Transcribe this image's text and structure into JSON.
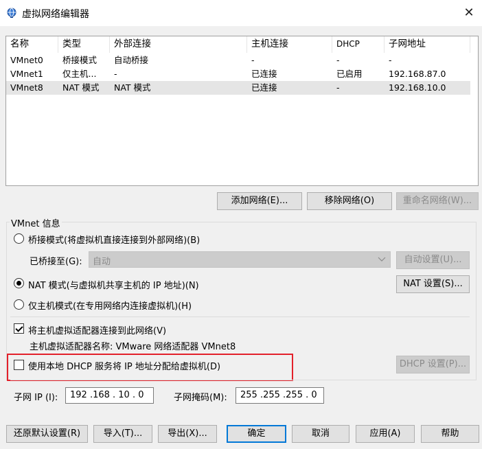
{
  "window": {
    "title": "虚拟网络编辑器",
    "close_label": "✕"
  },
  "list": {
    "headers": [
      "名称",
      "类型",
      "外部连接",
      "主机连接",
      "DHCP",
      "子网地址"
    ],
    "rows": [
      {
        "name": "VMnet0",
        "type": "桥接模式",
        "external": "自动桥接",
        "host": "-",
        "dhcp": "-",
        "subnet": "-"
      },
      {
        "name": "VMnet1",
        "type": "仅主机...",
        "external": "-",
        "host": "已连接",
        "dhcp": "已启用",
        "subnet": "192.168.87.0"
      },
      {
        "name": "VMnet8",
        "type": "NAT 模式",
        "external": "NAT 模式",
        "host": "已连接",
        "dhcp": "-",
        "subnet": "192.168.10.0"
      }
    ]
  },
  "list_buttons": {
    "add": "添加网络(E)...",
    "remove": "移除网络(O)",
    "rename": "重命名网络(W)..."
  },
  "vmnet_info": {
    "group_label": "VMnet 信息",
    "bridged_label": "桥接模式(将虚拟机直接连接到外部网络)(B)",
    "bridged_to_label": "已桥接至(G):",
    "bridged_to_value": "自动",
    "auto_settings": "自动设置(U)...",
    "nat_label": "NAT 模式(与虚拟机共享主机的 IP 地址)(N)",
    "nat_settings": "NAT 设置(S)...",
    "hostonly_label": "仅主机模式(在专用网络内连接虚拟机)(H)",
    "connect_adapter_label": "将主机虚拟适配器连接到此网络(V)",
    "adapter_name_label": "主机虚拟适配器名称: VMware 网络适配器 VMnet8",
    "dhcp_label": "使用本地 DHCP 服务将 IP 地址分配给虚拟机(D)",
    "dhcp_settings": "DHCP 设置(P)...",
    "subnet_ip_label": "子网 IP (I):",
    "subnet_ip_value": "192 .168 . 10  .  0",
    "subnet_mask_label": "子网掩码(M):",
    "subnet_mask_value": "255 .255 .255 .  0"
  },
  "footer": {
    "restore": "还原默认设置(R)",
    "import": "导入(T)...",
    "export": "导出(X)...",
    "ok": "确定",
    "cancel": "取消",
    "apply": "应用(A)",
    "help": "帮助"
  },
  "colors": {
    "highlight_border": "#e3202a",
    "selected_row": "#e5e5e5",
    "window_bg": "#f0f0f0"
  }
}
